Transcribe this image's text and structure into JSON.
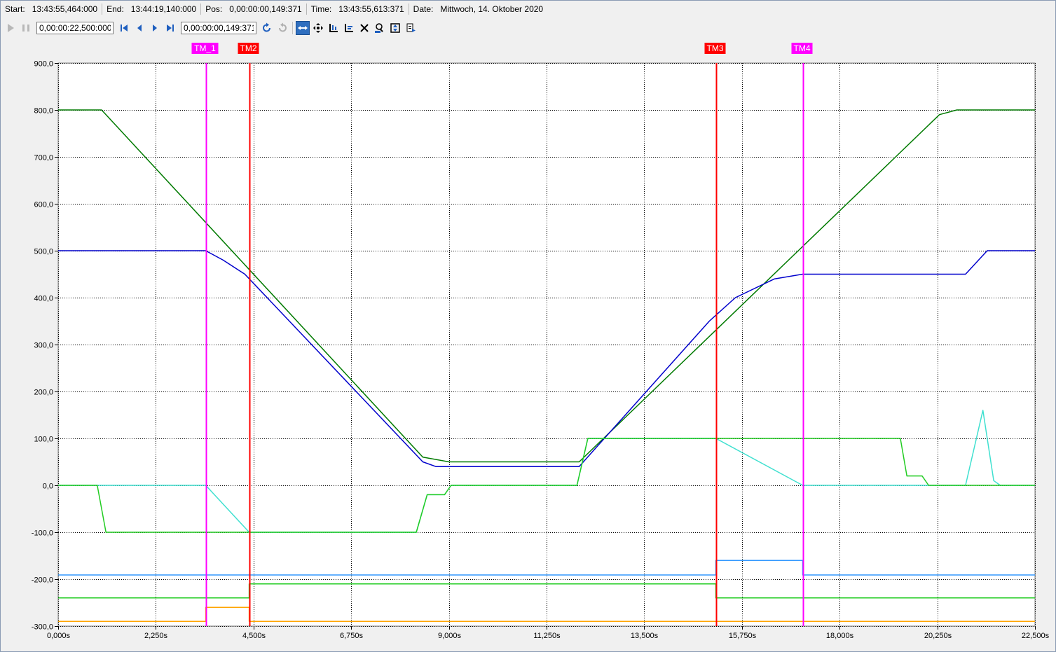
{
  "info_bar": {
    "start_label": "Start:",
    "start_value": "13:43:55,464:000",
    "end_label": "End:",
    "end_value": "13:44:19,140:000",
    "pos_label": "Pos:",
    "pos_value": "0,00:00:00,149:371",
    "time_label": "Time:",
    "time_value": "13:43:55,613:371",
    "date_label": "Date:",
    "date_value": "Mittwoch, 14. Oktober 2020"
  },
  "toolbar": {
    "range_value": "0,00:00:22,500:000",
    "position_value": "0,00:00:00,149:371",
    "icons": [
      "play-icon",
      "pause-icon",
      "skip-start-icon",
      "step-back-icon",
      "step-forward-icon",
      "skip-end-icon",
      "undo-icon",
      "redo-icon",
      "pan-icon",
      "move-icon",
      "zoom-x-icon",
      "zoom-y-icon",
      "clear-icon",
      "zoom-max-icon",
      "fit-icon",
      "export-icon"
    ]
  },
  "colors": {
    "plot_bg": "#ffffff",
    "grid": "#000000",
    "magenta": "#ff00ff",
    "red": "#ff0000",
    "dark_green": "#007a00",
    "blue": "#0000cc",
    "cyan": "#40e0d0",
    "light_green": "#22cc22",
    "sky_blue": "#3399ff",
    "orange": "#ffa500"
  },
  "chart_data": {
    "type": "line",
    "xlim": [
      0,
      22.5
    ],
    "ylim": [
      -300,
      900
    ],
    "grid": true,
    "x_ticks": [
      0,
      2.25,
      4.5,
      6.75,
      9,
      11.25,
      13.5,
      15.75,
      18,
      20.25,
      22.5
    ],
    "x_tick_labels": [
      "0,000s",
      "2,250s",
      "4,500s",
      "6,750s",
      "9,000s",
      "11,250s",
      "13,500s",
      "15,750s",
      "18,000s",
      "20,250s",
      "22,500s"
    ],
    "y_ticks": [
      900,
      800,
      700,
      600,
      500,
      400,
      300,
      200,
      100,
      0,
      -100,
      -200,
      -300
    ],
    "y_tick_labels": [
      "900,0",
      "800,0",
      "700,0",
      "600,0",
      "500,0",
      "400,0",
      "300,0",
      "200,0",
      "100,0",
      "0,0",
      "-100,0",
      "-200,0",
      "-300,0"
    ],
    "markers": [
      {
        "label": "TM_1",
        "x": 3.4,
        "color": "#ff00ff"
      },
      {
        "label": "TM2",
        "x": 4.4,
        "color": "#ff0000"
      },
      {
        "label": "TM3",
        "x": 15.15,
        "color": "#ff0000"
      },
      {
        "label": "TM4",
        "x": 17.15,
        "color": "#ff00ff"
      }
    ],
    "series": [
      {
        "color": "#007a00",
        "points": [
          [
            0,
            800
          ],
          [
            1,
            800
          ],
          [
            8.4,
            60
          ],
          [
            9,
            50
          ],
          [
            12,
            50
          ],
          [
            20.3,
            790
          ],
          [
            20.7,
            800
          ],
          [
            22.5,
            800
          ]
        ]
      },
      {
        "color": "#0000cc",
        "points": [
          [
            0,
            500
          ],
          [
            3.4,
            500
          ],
          [
            3.8,
            480
          ],
          [
            4.3,
            450
          ],
          [
            8.4,
            50
          ],
          [
            8.7,
            40
          ],
          [
            12,
            40
          ],
          [
            15,
            350
          ],
          [
            15.6,
            400
          ],
          [
            16.5,
            440
          ],
          [
            17.15,
            450
          ],
          [
            20.9,
            450
          ],
          [
            21.2,
            480
          ],
          [
            21.4,
            500
          ],
          [
            22.5,
            500
          ]
        ]
      },
      {
        "color": "#40e0d0",
        "points": [
          [
            0,
            0
          ],
          [
            3.4,
            0
          ],
          [
            4.4,
            -100
          ],
          [
            8.25,
            -100
          ],
          [
            8.5,
            -20
          ],
          [
            8.9,
            -20
          ],
          [
            9.05,
            0
          ],
          [
            11.95,
            0
          ],
          [
            12.2,
            100
          ],
          [
            15.15,
            100
          ],
          [
            17.15,
            0
          ],
          [
            20.9,
            0
          ],
          [
            21.3,
            160
          ],
          [
            21.55,
            10
          ],
          [
            21.7,
            0
          ],
          [
            22.5,
            0
          ]
        ]
      },
      {
        "color": "#22cc22",
        "points": [
          [
            0,
            0
          ],
          [
            0.9,
            0
          ],
          [
            1.1,
            -100
          ],
          [
            4.4,
            -100
          ],
          [
            8.25,
            -100
          ],
          [
            8.5,
            -20
          ],
          [
            8.9,
            -20
          ],
          [
            9.05,
            0
          ],
          [
            11.95,
            0
          ],
          [
            12.2,
            100
          ],
          [
            19.4,
            100
          ],
          [
            19.55,
            20
          ],
          [
            19.9,
            20
          ],
          [
            20.05,
            0
          ],
          [
            22.5,
            0
          ]
        ]
      },
      {
        "color": "#3399ff",
        "points": [
          [
            0,
            -191
          ],
          [
            15.15,
            -191
          ],
          [
            15.15,
            -160
          ],
          [
            17.15,
            -160
          ],
          [
            17.15,
            -191
          ],
          [
            22.5,
            -191
          ]
        ]
      },
      {
        "color": "#22cc22",
        "points": [
          [
            0,
            -240
          ],
          [
            4.4,
            -240
          ],
          [
            4.4,
            -210
          ],
          [
            15.15,
            -210
          ],
          [
            15.15,
            -240
          ],
          [
            22.5,
            -240
          ]
        ]
      },
      {
        "color": "#ffa500",
        "points": [
          [
            0,
            -290
          ],
          [
            3.4,
            -290
          ],
          [
            3.4,
            -260
          ],
          [
            4.4,
            -260
          ],
          [
            4.4,
            -290
          ],
          [
            22.5,
            -290
          ]
        ]
      }
    ]
  }
}
